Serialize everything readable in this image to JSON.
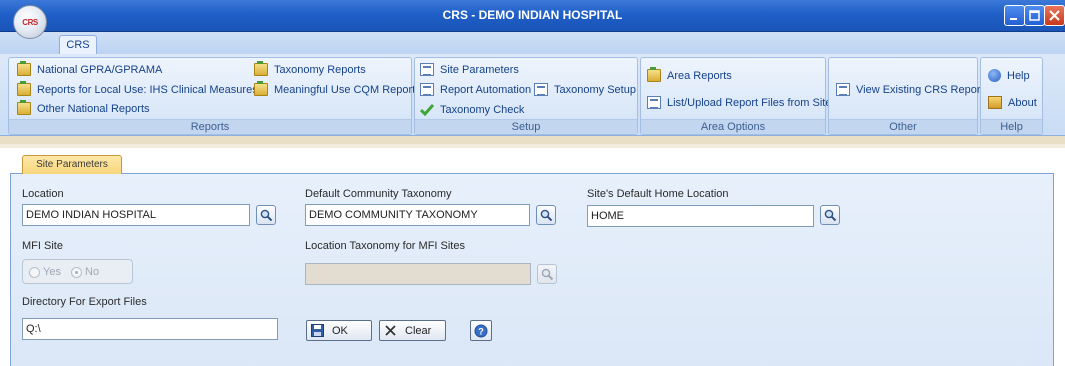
{
  "window": {
    "title": "CRS - DEMO INDIAN HOSPITAL",
    "app_orb_text": "CRS"
  },
  "ribbon": {
    "tab": "CRS",
    "groups": {
      "reports": {
        "label": "Reports",
        "items": [
          "National GPRA/GPRAMA",
          "Reports for Local Use: IHS Clinical Measures",
          "Other National Reports",
          "Taxonomy Reports",
          "Meaningful Use CQM Reports"
        ]
      },
      "setup": {
        "label": "Setup",
        "items": [
          "Site Parameters",
          "Report Automation",
          "Taxonomy Setup",
          "Taxonomy Check"
        ]
      },
      "area_options": {
        "label": "Area Options",
        "items": [
          "Area Reports",
          "List/Upload Report Files from Site"
        ]
      },
      "other": {
        "label": "Other",
        "items": [
          "View Existing CRS Reports"
        ]
      },
      "help": {
        "label": "Help",
        "items": [
          "Help",
          "About"
        ]
      }
    }
  },
  "panel": {
    "tab": "Site Parameters",
    "location": {
      "label": "Location",
      "value": "DEMO INDIAN HOSPITAL"
    },
    "default_taxonomy": {
      "label": "Default Community Taxonomy",
      "value": "DEMO COMMUNITY TAXONOMY"
    },
    "home_location": {
      "label": "Site's Default Home Location",
      "value": "HOME"
    },
    "mfi_site": {
      "label": "MFI Site",
      "options": [
        "Yes",
        "No"
      ],
      "selected": "No"
    },
    "mfi_taxonomy": {
      "label": "Location Taxonomy for MFI Sites",
      "value": ""
    },
    "export_dir": {
      "label": "Directory For Export Files",
      "value": "Q:\\"
    },
    "buttons": {
      "ok": "OK",
      "clear": "Clear"
    }
  }
}
